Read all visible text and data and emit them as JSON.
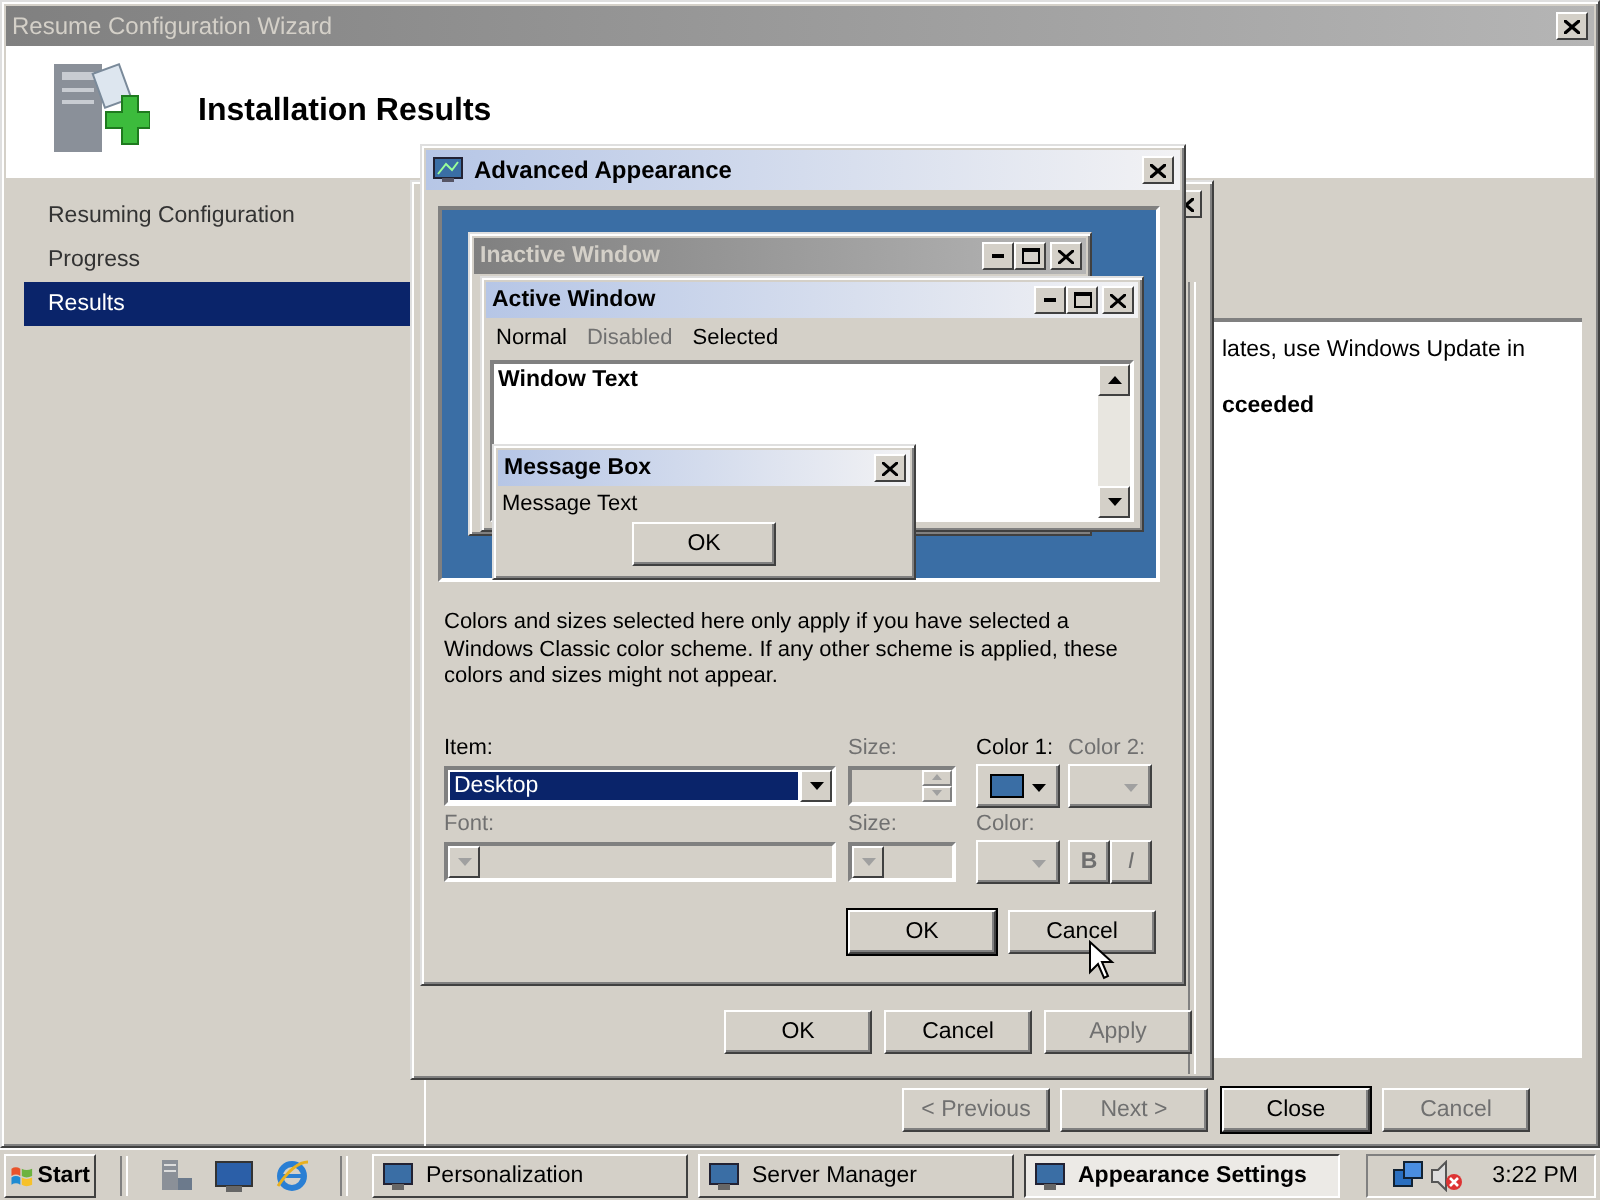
{
  "wizard": {
    "title": "Resume Configuration Wizard",
    "heading": "Installation Results",
    "steps": [
      {
        "label": "Resuming Configuration",
        "selected": false
      },
      {
        "label": "Progress",
        "selected": false
      },
      {
        "label": "Results",
        "selected": true
      }
    ],
    "result_lines": [
      {
        "text": "lates, use Windows Update in",
        "bold": false
      },
      {
        "text": "cceeded",
        "bold": true
      }
    ],
    "buttons": [
      {
        "label": "< Previous",
        "disabled": true,
        "default": false
      },
      {
        "label": "Next >",
        "disabled": true,
        "default": false
      },
      {
        "label": "Close",
        "disabled": false,
        "default": true
      },
      {
        "label": "Cancel",
        "disabled": true,
        "default": false
      }
    ]
  },
  "appearance_settings": {
    "buttons": [
      {
        "label": "OK",
        "disabled": false
      },
      {
        "label": "Cancel",
        "disabled": false
      },
      {
        "label": "Apply",
        "disabled": true
      }
    ]
  },
  "advanced_appearance": {
    "title": "Advanced Appearance",
    "preview": {
      "inactive_title": "Inactive Window",
      "active_title": "Active Window",
      "menu": [
        {
          "label": "Normal",
          "disabled": false
        },
        {
          "label": "Disabled",
          "disabled": true
        },
        {
          "label": "Selected",
          "disabled": false
        }
      ],
      "window_text": "Window Text",
      "message_title": "Message Box",
      "message_text": "Message Text",
      "message_button": "OK"
    },
    "description": "Colors and sizes selected here only apply if you have selected a Windows Classic color scheme. If any other scheme is applied, these colors and sizes might not appear.",
    "item": {
      "label": "Item:",
      "value": "Desktop"
    },
    "item_size": {
      "label": "Size:",
      "disabled": true
    },
    "color1": {
      "label": "Color 1:",
      "disabled": false,
      "color": "#3a6ea5"
    },
    "color2": {
      "label": "Color 2:",
      "disabled": true
    },
    "font": {
      "label": "Font:",
      "disabled": true
    },
    "font_size": {
      "label": "Size:",
      "disabled": true
    },
    "font_color": {
      "label": "Color:",
      "disabled": true
    },
    "bold_button": {
      "label": "B",
      "disabled": true
    },
    "italic_button": {
      "label": "I",
      "disabled": true
    },
    "buttons": [
      {
        "label": "OK",
        "default": true
      },
      {
        "label": "Cancel",
        "default": false
      }
    ]
  },
  "taskbar": {
    "start": "Start",
    "tasks": [
      {
        "label": "Personalization",
        "selected": false
      },
      {
        "label": "Server Manager",
        "selected": false
      },
      {
        "label": "Appearance Settings",
        "selected": true
      }
    ],
    "clock": "3:22 PM"
  }
}
